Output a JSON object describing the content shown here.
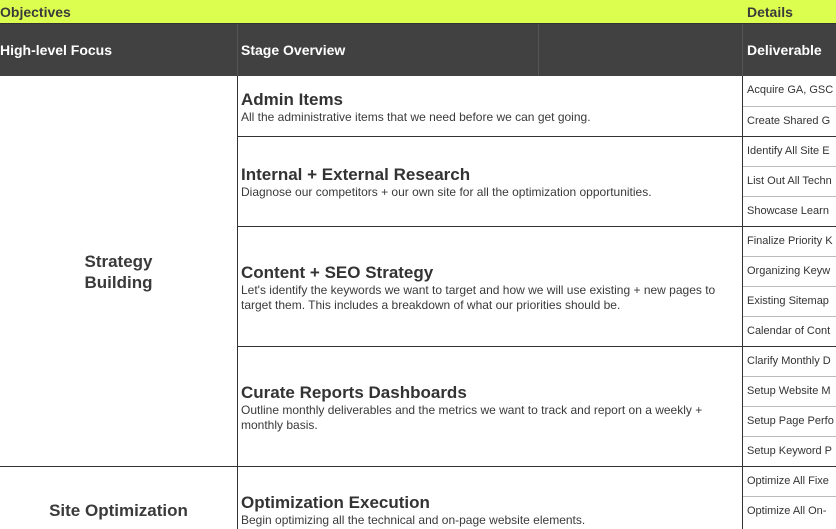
{
  "top": {
    "objectives": "Objectives",
    "details": "Details"
  },
  "header": {
    "focus": "High-level Focus",
    "stage": "Stage Overview",
    "deliverable": "Deliverable"
  },
  "focus": {
    "strategy": "Strategy\nBuilding",
    "site": "Site Optimization"
  },
  "stages": [
    {
      "title": "Admin Items",
      "desc": "All the administrative items that we need before we can get going."
    },
    {
      "title": "Internal + External Research",
      "desc": "Diagnose our competitors + our own site for all the optimization opportunities."
    },
    {
      "title": "Content + SEO Strategy",
      "desc": "Let's identify the keywords we want to target and how we will use existing + new pages to target them. This includes a breakdown of what our priorities should be."
    },
    {
      "title": "Curate Reports Dashboards",
      "desc": "Outline monthly deliverables and the metrics we want to track and report on a weekly + monthly basis."
    },
    {
      "title": "Optimization Execution",
      "desc": "Begin optimizing all the technical and on-page website elements."
    }
  ],
  "deliverables": [
    "Acquire GA, GSC",
    "Create Shared G",
    "Identify All Site E",
    "List Out All Techn",
    "Showcase Learn",
    "Finalize Priority K",
    "Organizing Keyw",
    "Existing Sitemap",
    "Calendar of Cont",
    "Clarify Monthly D",
    "Setup Website M",
    "Setup Page Perfo",
    "Setup Keyword P",
    "Optimize All Fixe",
    "Optimize All On-"
  ]
}
